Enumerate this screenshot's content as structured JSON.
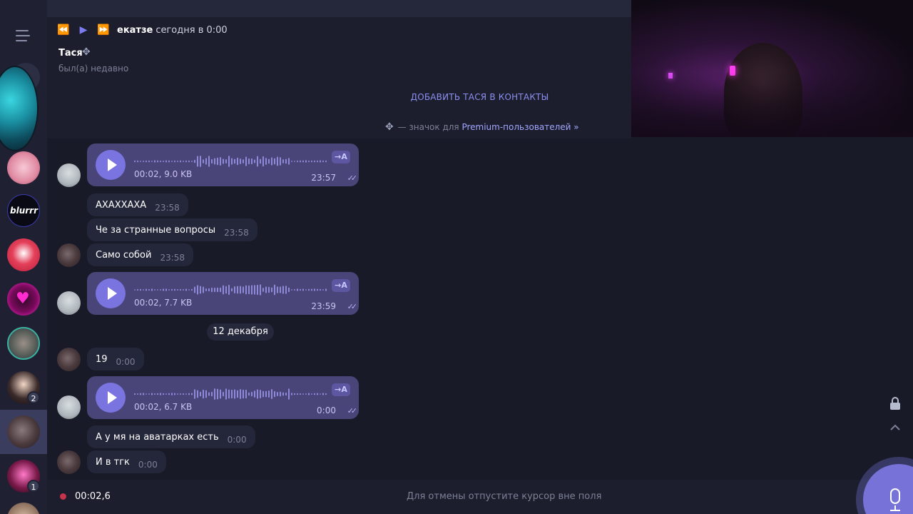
{
  "player": {
    "name": "екатзе",
    "time": "сегодня в 0:00"
  },
  "contact": {
    "name": "Тася",
    "status": "был(а) недавно",
    "add_contact": "ДОБАВИТЬ ТАСЯ В КОНТАКТЫ",
    "premium_note": "— значок для ",
    "premium_link": "Premium-пользователей »"
  },
  "sidebar": {
    "badges": [
      "2",
      "1"
    ]
  },
  "messages": {
    "voice": [
      {
        "meta": "00:02, 9.0 KB",
        "time": "23:57",
        "transcribe": "→A"
      },
      {
        "meta": "00:02, 7.7 KB",
        "time": "23:59",
        "transcribe": "→A"
      },
      {
        "meta": "00:02, 6.7 KB",
        "time": "0:00",
        "transcribe": "→A"
      }
    ],
    "text": [
      {
        "text": "АХАХХАХА",
        "time": "23:58"
      },
      {
        "text": "Че за странные вопросы",
        "time": "23:58"
      },
      {
        "text": "Само собой",
        "time": "23:58"
      },
      {
        "text": "19",
        "time": "0:00"
      },
      {
        "text": "А у мя на аватарках есть",
        "time": "0:00"
      },
      {
        "text": "И в тгк",
        "time": "0:00"
      }
    ],
    "date_separator": "12 декабря"
  },
  "recording": {
    "time": "00:02,6",
    "hint": "Для отмены отпустите курсор вне поля"
  },
  "colors": {
    "accent": "#7672d8",
    "voice_bubble": "#4a4578",
    "text_bubble": "#24263a",
    "record_dot": "#c8324a"
  }
}
